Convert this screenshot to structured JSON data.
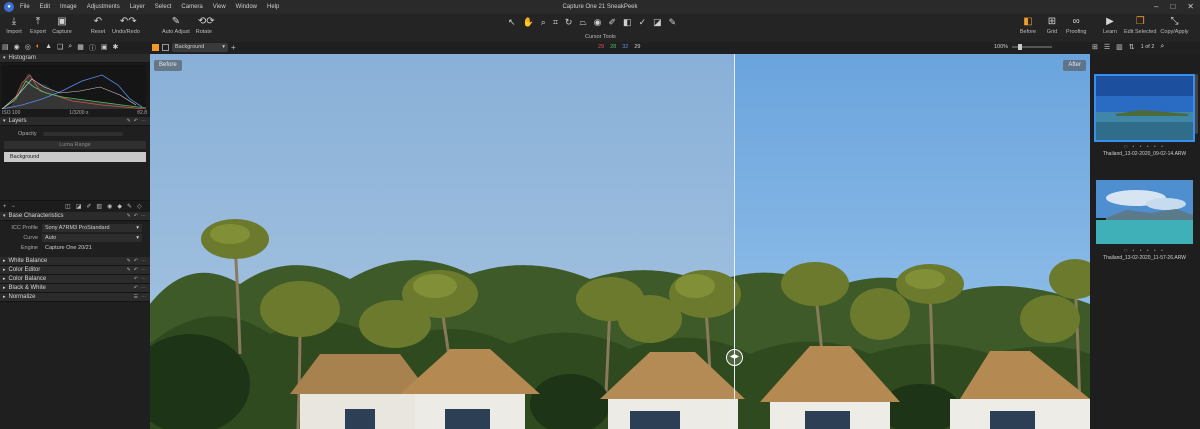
{
  "menubar": {
    "items": [
      "File",
      "Edit",
      "Image",
      "Adjustments",
      "Layer",
      "Select",
      "Camera",
      "View",
      "Window",
      "Help"
    ],
    "title": "Capture One 21 SneakPeek"
  },
  "toolbar": {
    "import": "Import",
    "export": "Export",
    "capture": "Capture",
    "reset": "Reset",
    "undo_redo": "Undo/Redo",
    "auto_adjust": "Auto Adjust",
    "rotate": "Rotate",
    "cursor_tools": "Cursor Tools",
    "before": "Before",
    "grid": "Grid",
    "proofing": "Proofing",
    "learn": "Learn",
    "edit_selected": "Edit Selected",
    "copy_apply": "Copy/Apply"
  },
  "subbar": {
    "layer_dropdown": "Background",
    "rgb": {
      "r": "29",
      "g": "28",
      "b": "32",
      "l": "29"
    },
    "zoom": "100%",
    "count": "1 of 2"
  },
  "histogram": {
    "title": "Histogram",
    "iso": "ISO 100",
    "shutter": "1/3200 s",
    "aperture": "f/2.8"
  },
  "layers": {
    "title": "Layers",
    "opacity_label": "Opacity",
    "luma_range": "Luma Range",
    "background_layer": "Background"
  },
  "base_characteristics": {
    "title": "Base Characteristics",
    "icc_label": "ICC Profile",
    "icc_value": "Sony A7RM3 ProStandard",
    "curve_label": "Curve",
    "curve_value": "Auto",
    "engine_label": "Engine",
    "engine_value": "Capture One 20/21"
  },
  "tools": [
    "White Balance",
    "Color Editor",
    "Color Balance",
    "Black & White",
    "Normalize"
  ],
  "viewer": {
    "before_label": "Before",
    "after_label": "After"
  },
  "browser": {
    "thumbs": [
      {
        "name": "Thailand_13-02-2020_09-02-14.ARW"
      },
      {
        "name": "Thailand_13-02-2020_11-57-26.ARW"
      }
    ]
  },
  "colors": {
    "accent": "#f39a2a",
    "selection": "#3a8ef0"
  }
}
